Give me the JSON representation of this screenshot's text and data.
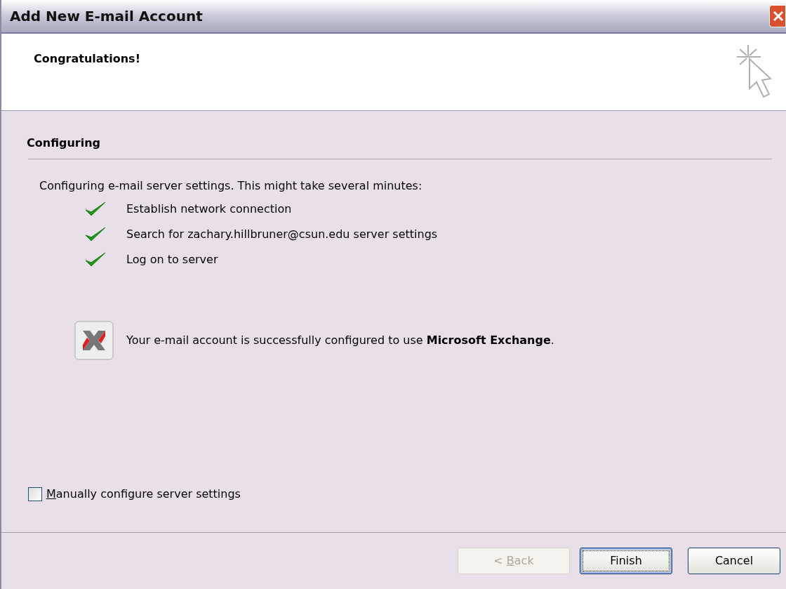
{
  "window": {
    "title": "Add New E-mail Account"
  },
  "header": {
    "title": "Congratulations!"
  },
  "section": {
    "title": "Configuring"
  },
  "intro": "Configuring e-mail server settings. This might take several minutes:",
  "steps": [
    {
      "label": "Establish network connection",
      "done": true
    },
    {
      "label": "Search for zachary.hillbruner@csun.edu server settings",
      "done": true
    },
    {
      "label": "Log on to server",
      "done": true
    }
  ],
  "result": "Your e-mail account is successfully configured to use **Microsoft Exchange**.",
  "manual_checkbox": {
    "access_key": "M",
    "label_rest": "anually configure server settings",
    "checked": false
  },
  "buttons": [
    {
      "prefix": "< ",
      "access_key": "B",
      "label_rest": "ack",
      "disabled": true,
      "default": false
    },
    {
      "label": "Finish",
      "disabled": false,
      "default": true
    },
    {
      "label": "Cancel",
      "disabled": false,
      "default": false
    }
  ]
}
